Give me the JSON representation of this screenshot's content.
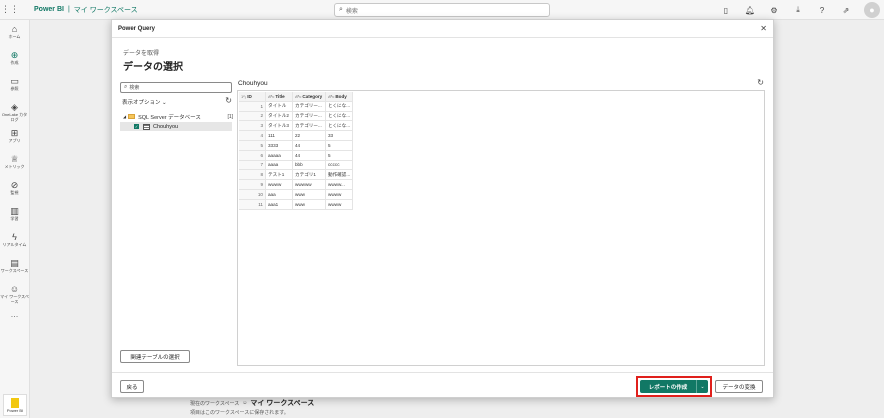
{
  "topbar": {
    "brand": "Power BI",
    "separator": "|",
    "workspace": "マイ ワークスペース",
    "search_placeholder": "検索"
  },
  "leftnav": {
    "items": [
      {
        "icon": "home-icon",
        "label": "ホーム"
      },
      {
        "icon": "create-icon",
        "label": "作成"
      },
      {
        "icon": "browse-icon",
        "label": "参照"
      },
      {
        "icon": "onelake-icon",
        "label": "OneLake カタログ"
      },
      {
        "icon": "apps-icon",
        "label": "アプリ"
      },
      {
        "icon": "metrics-icon",
        "label": "メトリック"
      },
      {
        "icon": "monitor-icon",
        "label": "監視"
      },
      {
        "icon": "learn-icon",
        "label": "学習"
      },
      {
        "icon": "realtime-icon",
        "label": "リアルタイム"
      },
      {
        "icon": "workspaces-icon",
        "label": "ワークスペース"
      },
      {
        "icon": "my-workspace-icon",
        "label": "マイ ワークスペース"
      }
    ],
    "more": "…",
    "bottom_tile": "Power BI"
  },
  "background": {
    "current_ws_label": "現在のワークスペース",
    "current_ws_name": "マイ ワークスペース",
    "note": "項目はこのワークスペースに保存されます。"
  },
  "dialog": {
    "title": "Power Query",
    "subtitle": "データを取得",
    "heading": "データの選択",
    "nav": {
      "search_placeholder": "検索",
      "display_options": "表示オプション",
      "server_label": "SQL Server データベース",
      "server_count": "[1]",
      "table_name": "Chouhyou",
      "related_button": "関連テーブルの選択"
    },
    "preview": {
      "title": "Chouhyou",
      "columns": [
        "ID",
        "Title",
        "Category",
        "Body"
      ],
      "rows": [
        [
          "1",
          "タイトル",
          "カテゴリー...",
          "とくにな..."
        ],
        [
          "2",
          "タイトル2",
          "カテゴリー...",
          "とくにな..."
        ],
        [
          "3",
          "タイトル3",
          "カテゴリー...",
          "とくにな..."
        ],
        [
          "4",
          "111",
          "22",
          "33"
        ],
        [
          "5",
          "3333",
          "44",
          "5"
        ],
        [
          "6",
          "aaaaa",
          "44",
          "5"
        ],
        [
          "7",
          "aaaa",
          "bbb",
          "ccccc"
        ],
        [
          "8",
          "テスト1",
          "カテゴリ1",
          "動作確認..."
        ],
        [
          "9",
          "wwww",
          "wwwww",
          "wwww..."
        ],
        [
          "10",
          "aaa",
          "www",
          "wwww"
        ],
        [
          "11",
          "aaa1",
          "www",
          "wwww"
        ]
      ]
    },
    "footer": {
      "back": "戻る",
      "create_report": "レポートの作成",
      "transform": "データの変換"
    }
  }
}
